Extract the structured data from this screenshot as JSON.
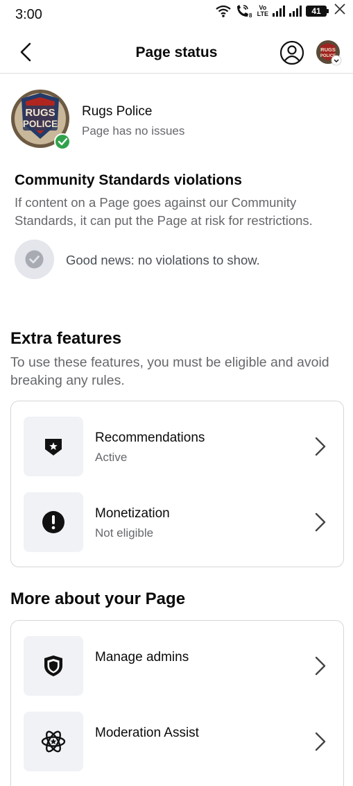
{
  "status_bar": {
    "time": "3:00",
    "volte_top": "Vo",
    "volte_bottom": "LTE",
    "sim_sub": "8",
    "battery": "41",
    "icons": [
      "wifi-icon",
      "wifi-call-icon",
      "volte-icon",
      "signal-icon",
      "signal-icon",
      "battery-icon",
      "close-icon"
    ]
  },
  "header": {
    "title": "Page status",
    "back_icon": "chevron-left-icon",
    "account_icon": "account-circle-icon"
  },
  "profile": {
    "name": "Rugs Police",
    "status": "Page has no issues",
    "logo_line1": "RUGS",
    "logo_line2": "POLICE",
    "badge_color": "#31a24c"
  },
  "community_standards": {
    "title": "Community Standards violations",
    "description": "If content on a Page goes against our Community Standards, it can put the Page at risk for restrictions.",
    "good_news": "Good news: no violations to show."
  },
  "extra_features": {
    "title": "Extra features",
    "description": "To use these features, you must be eligible and avoid breaking any rules.",
    "items": [
      {
        "title": "Recommendations",
        "status": "Active",
        "icon": "shield-star-icon"
      },
      {
        "title": "Monetization",
        "status": "Not eligible",
        "icon": "alert-circle-icon"
      }
    ]
  },
  "more_about": {
    "title": "More about your Page",
    "items": [
      {
        "title": "Manage admins",
        "icon": "shield-icon"
      },
      {
        "title": "Moderation Assist",
        "icon": "atom-icon"
      }
    ]
  },
  "colors": {
    "secondary_text": "#65676b",
    "icon_tile": "#f0f2f5",
    "divider": "#d6d6d6"
  }
}
